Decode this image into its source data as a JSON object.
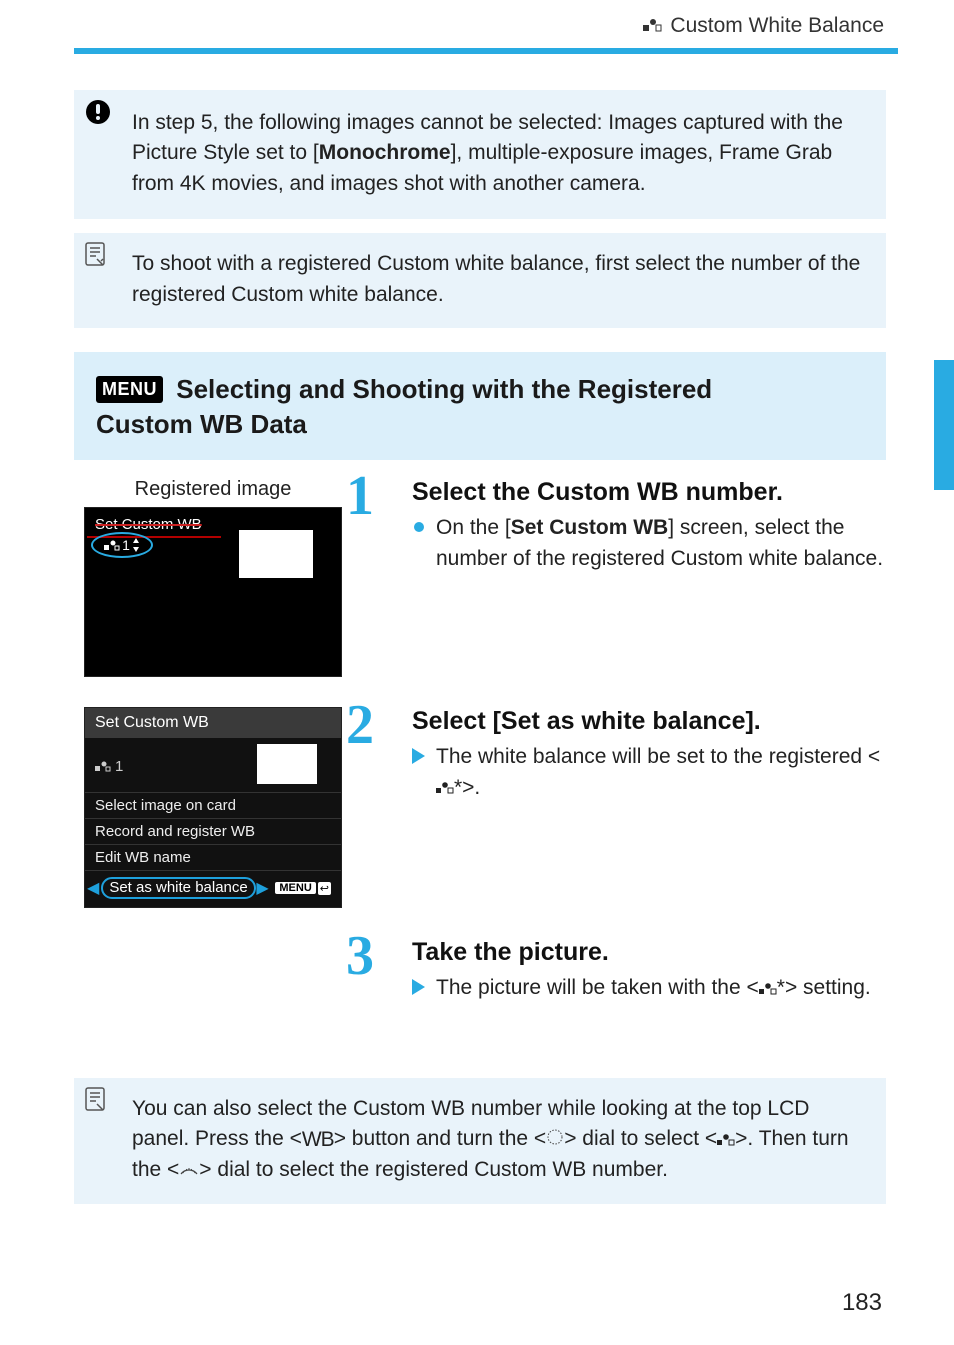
{
  "header": {
    "breadcrumb": "Custom White Balance"
  },
  "notes": {
    "warning": "In step 5, the following images cannot be selected: Images captured with the Picture Style set to [",
    "warning_bold": "Monochrome",
    "warning_tail": "], multiple-exposure images, Frame Grab from 4K movies, and images shot with another camera.",
    "tip1": "To shoot with a registered Custom white balance, first select the number of the registered Custom white balance.",
    "tip2_a": "You can also select the Custom WB number while looking at the top LCD panel. Press the <",
    "tip2_b": "> button and turn the <",
    "tip2_c": "> dial to select <",
    "tip2_d": ">. Then turn the <",
    "tip2_e": "> dial to select the registered Custom WB number."
  },
  "section": {
    "menu_label": "MENU",
    "title_line1": "Selecting and Shooting with the Registered",
    "title_line2": "Custom WB Data"
  },
  "screens": {
    "s1_caption": "Registered image",
    "s1_title": "Set Custom WB",
    "s1_wb": "1",
    "s2_title": "Set Custom WB",
    "s2_wb": "1",
    "s2_item1": "Select image on card",
    "s2_item2": "Record and register WB",
    "s2_item3": "Edit WB name",
    "s2_button": "Set as white balance",
    "s2_menu": "MENU"
  },
  "steps": [
    {
      "num": "1",
      "title": "Select the Custom WB number.",
      "body_a": "On the [",
      "body_bold": "Set Custom WB",
      "body_b": "] screen, select the number of the registered Custom white balance."
    },
    {
      "num": "2",
      "title": "Select [Set as white balance].",
      "body_a": "The white balance will be set to the registered <",
      "body_b": "*>."
    },
    {
      "num": "3",
      "title": "Take the picture.",
      "body_a": "The picture will be taken with the <",
      "body_b": "*> setting."
    }
  ],
  "page_number": "183"
}
